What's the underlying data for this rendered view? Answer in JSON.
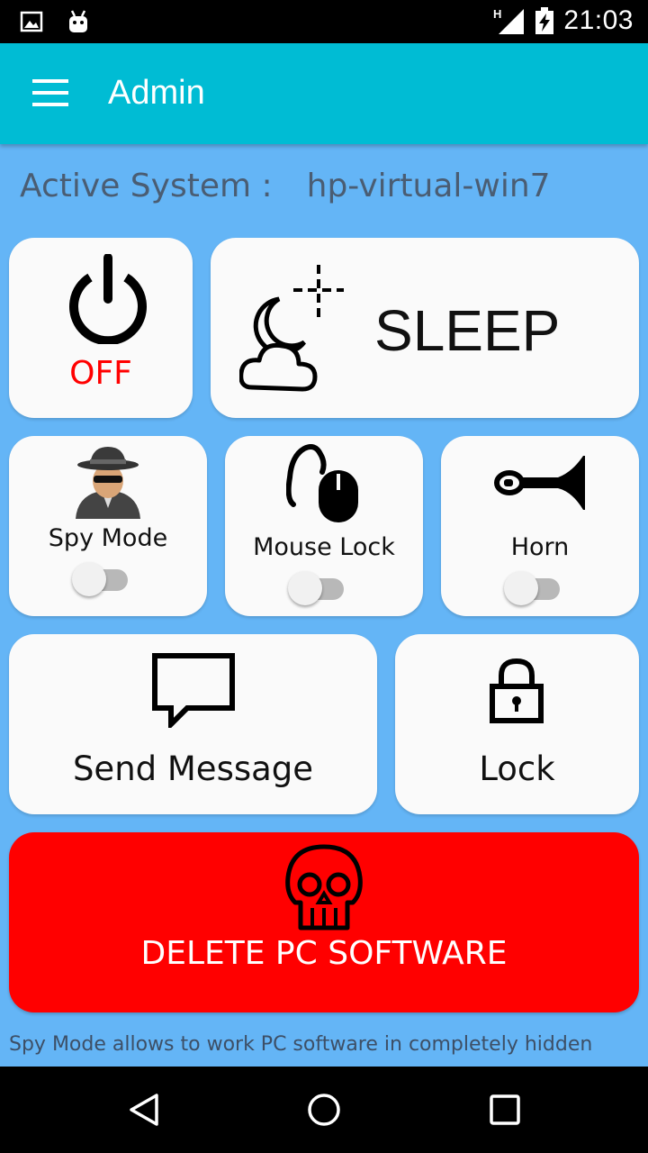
{
  "status_bar": {
    "time": "21:03",
    "network_type": "H",
    "icons": [
      "image-notification-icon",
      "android-notification-icon",
      "signal-icon",
      "battery-charging-icon"
    ]
  },
  "app_bar": {
    "title": "Admin",
    "menu_icon": "hamburger-menu-icon"
  },
  "system": {
    "label": "Active System :",
    "hostname": "hp-virtual-win7"
  },
  "controls": {
    "off": {
      "label": "OFF",
      "icon": "power-icon",
      "label_color": "#ff0000"
    },
    "sleep": {
      "label": "SLEEP",
      "icon": "moon-cloud-icon"
    },
    "spy_mode": {
      "label": "Spy Mode",
      "icon": "spy-icon",
      "enabled": false
    },
    "mouse_lock": {
      "label": "Mouse Lock",
      "icon": "mouse-icon",
      "enabled": false
    },
    "horn": {
      "label": "Horn",
      "icon": "horn-icon",
      "enabled": false
    },
    "send_message": {
      "label": "Send Message",
      "icon": "chat-bubble-icon"
    },
    "lock": {
      "label": "Lock",
      "icon": "padlock-icon"
    },
    "delete": {
      "label": "DELETE PC SOFTWARE",
      "icon": "skull-icon",
      "color": "#ff0000"
    }
  },
  "footer_note": "Spy Mode allows to work PC software in completely hidden",
  "nav_bar": {
    "buttons": [
      "back-icon",
      "home-icon",
      "recents-icon"
    ]
  },
  "colors": {
    "background": "#64b5f6",
    "app_bar": "#00bcd4",
    "card": "#fafafa"
  }
}
